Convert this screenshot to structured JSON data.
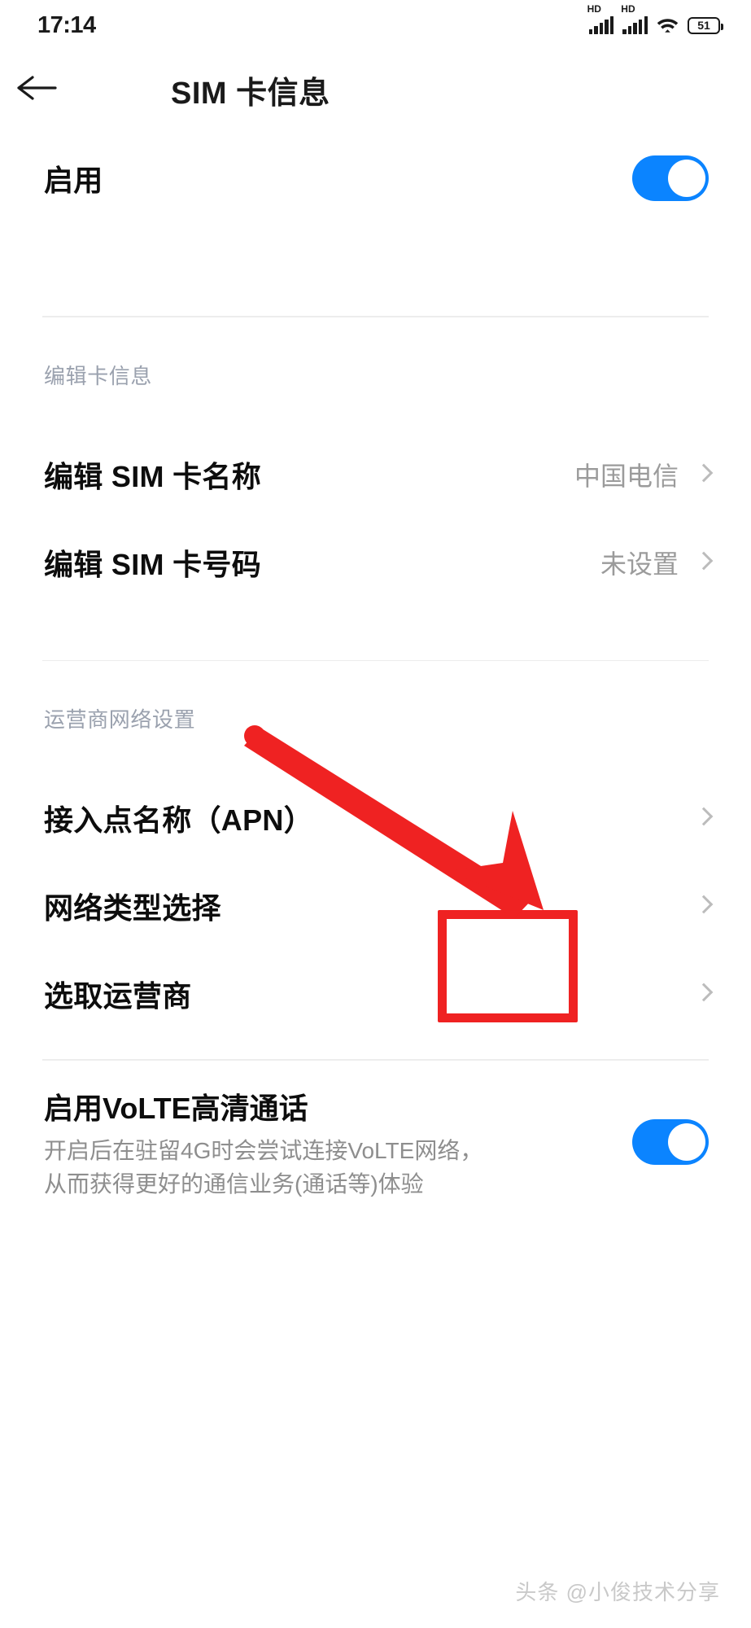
{
  "status_bar": {
    "time": "17:14",
    "signal_1_label": "HD",
    "signal_2_label": "HD",
    "wifi_icon": "wifi-icon",
    "battery_percent": "51"
  },
  "header": {
    "back_icon": "back-arrow-icon",
    "title": "SIM 卡信息"
  },
  "enable_row": {
    "label": "启用",
    "toggle_state": "on"
  },
  "sections": [
    {
      "label": "编辑卡信息",
      "rows": [
        {
          "label": "编辑 SIM 卡名称",
          "value": "中国电信",
          "chevron": "chevron-right-icon"
        },
        {
          "label": "编辑 SIM 卡号码",
          "value": "未设置",
          "chevron": "chevron-right-icon"
        }
      ]
    },
    {
      "label": "运营商网络设置",
      "rows": [
        {
          "label": "接入点名称（APN）",
          "value": "",
          "chevron": "chevron-right-icon"
        },
        {
          "label": "网络类型选择",
          "value": "",
          "chevron": "chevron-right-icon"
        },
        {
          "label": "选取运营商",
          "value": "",
          "chevron": "chevron-right-icon"
        }
      ]
    }
  ],
  "volte": {
    "title": "启用VoLTE高清通话",
    "description": "开启后在驻留4G时会尝试连接VoLTE网络，从而获得更好的通信业务(通话等)体验",
    "toggle_state": "on"
  },
  "annotations": {
    "arrow_color": "#ef2222",
    "highlight_box_color": "#ef2222"
  },
  "watermark": {
    "text": "头条 @小俊技术分享"
  },
  "colors": {
    "accent_blue": "#0b84ff",
    "section_label": "#9aa1ae",
    "value_gray": "#9b9b9b",
    "divider": "#ededed"
  }
}
